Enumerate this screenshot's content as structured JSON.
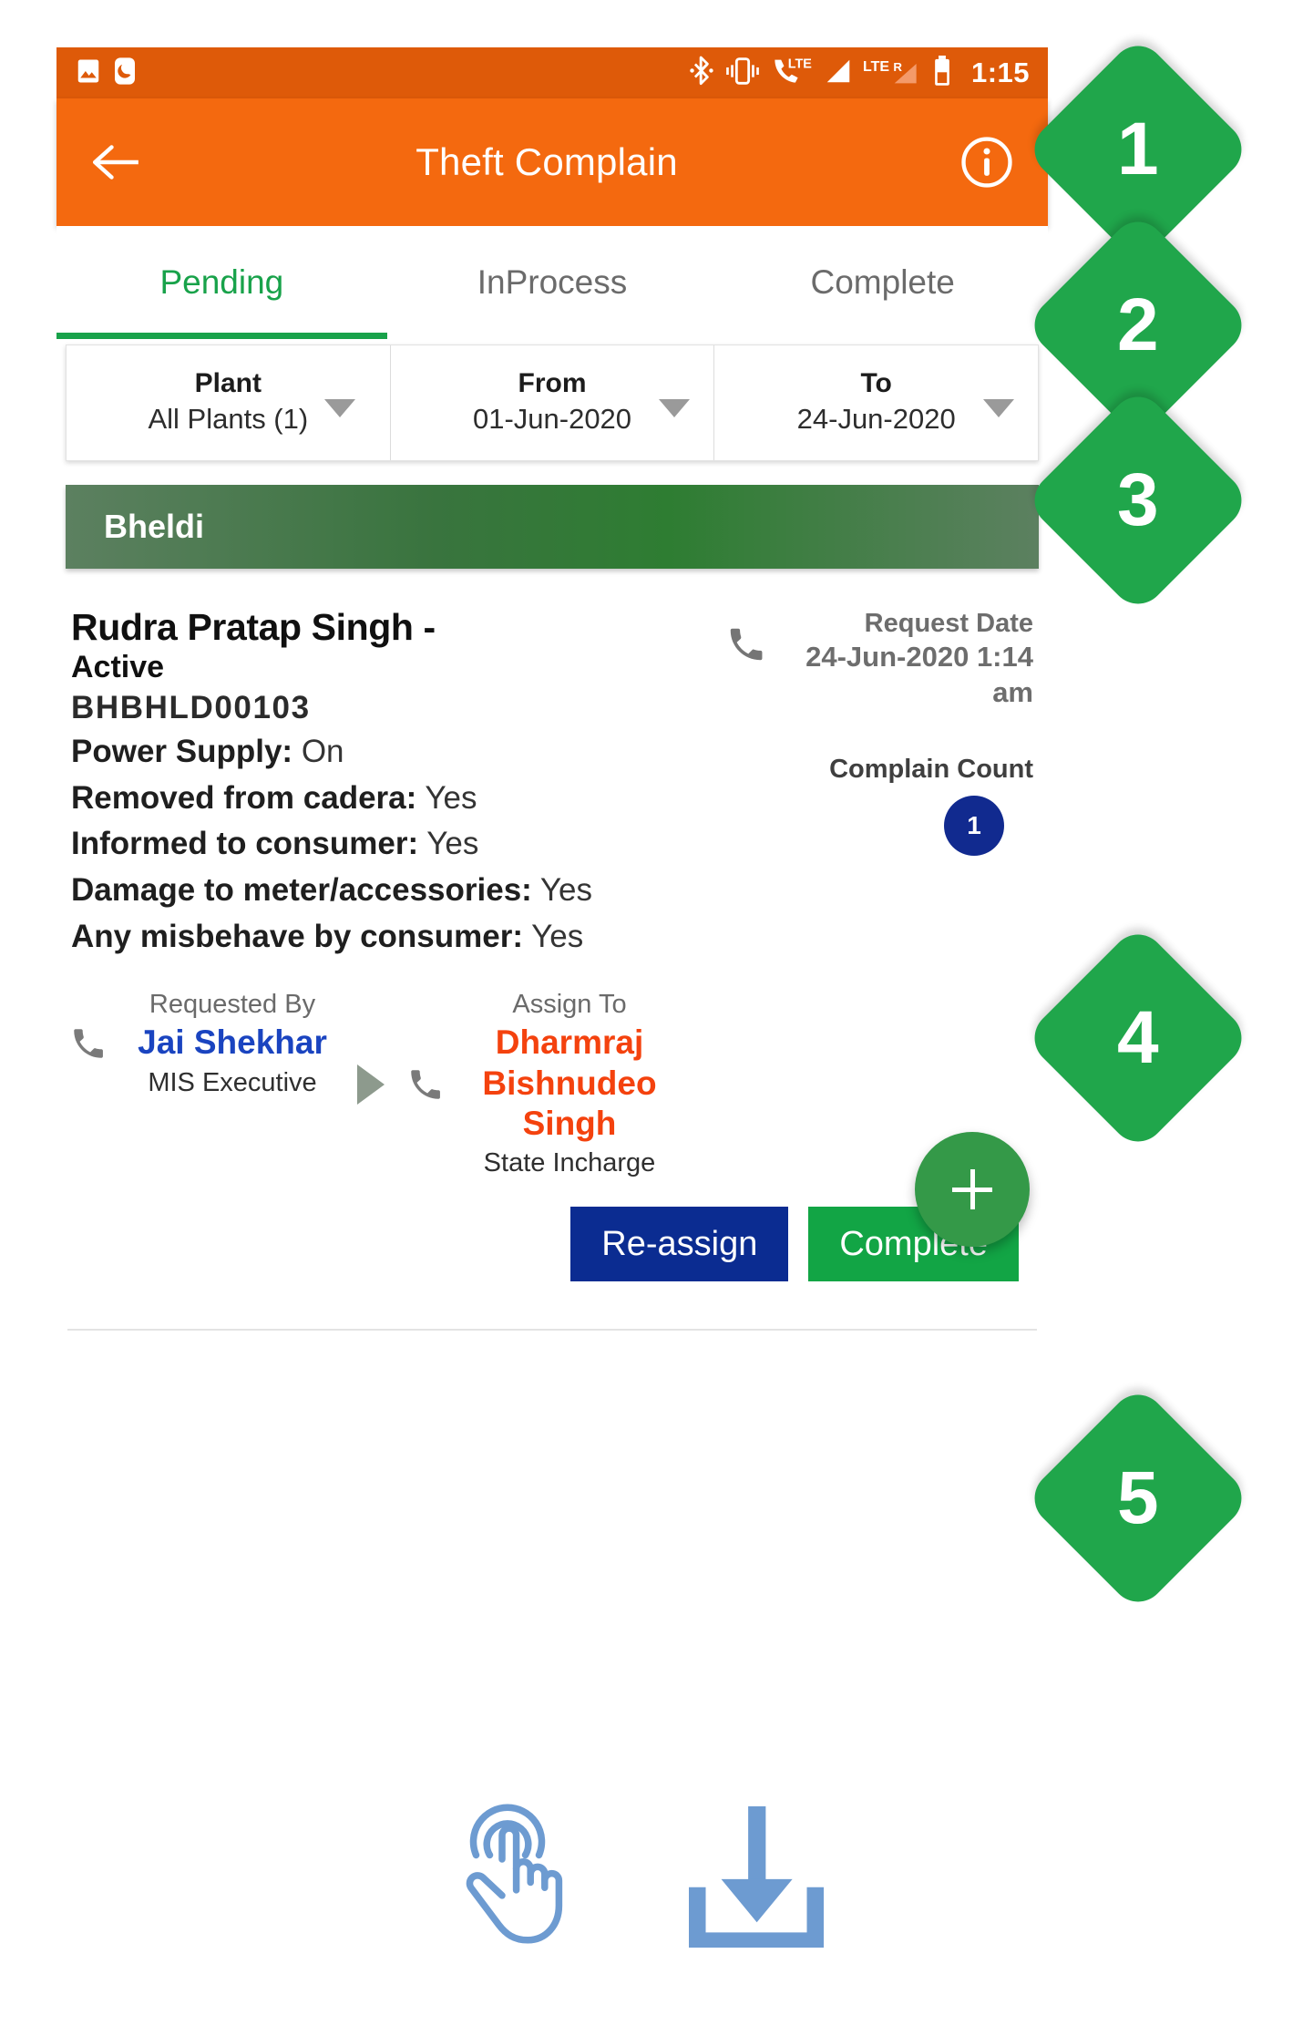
{
  "statusbar": {
    "time": "1:15",
    "icons": [
      "image-icon",
      "moon-icon",
      "bluetooth-icon",
      "vibrate-icon",
      "lte-call-icon",
      "signal-bars-icon",
      "lte-roaming-icon",
      "battery-icon"
    ],
    "lte_label": "LTE",
    "lte_roam_label": "LTE",
    "roam_label": "R",
    "bg_color": "#DE5A09"
  },
  "toolbar": {
    "back_icon": "back-arrow-icon",
    "title": "Theft Complain",
    "info_icon": "info-icon",
    "bg_color": "#F4690F"
  },
  "tabs": {
    "active_color": "#18A24A",
    "items": [
      {
        "label": "Pending",
        "active": true
      },
      {
        "label": "InProcess",
        "active": false
      },
      {
        "label": "Complete",
        "active": false
      }
    ]
  },
  "filters": [
    {
      "label": "Plant",
      "value": "All Plants (1)"
    },
    {
      "label": "From",
      "value": "01-Jun-2020"
    },
    {
      "label": "To",
      "value": "24-Jun-2020"
    }
  ],
  "group_header": {
    "title": "Bheldi",
    "color_start": "#5C8060",
    "color_mid": "#2E7D32"
  },
  "card": {
    "name": "Rudra Pratap Singh -",
    "status": "Active",
    "code": "BHBHLD00103",
    "details": [
      {
        "label": "Power Supply:",
        "value": "On"
      },
      {
        "label": "Removed from cadera:",
        "value": "Yes"
      },
      {
        "label": "Informed to consumer:",
        "value": "Yes"
      },
      {
        "label": "Damage to meter/accessories:",
        "value": "Yes"
      },
      {
        "label": "Any misbehave by consumer:",
        "value": "Yes"
      }
    ],
    "request_date_label": "Request Date",
    "request_date_value": "24-Jun-2020 1:14 am",
    "complain_count_label": "Complain Count",
    "complain_count_value": "1",
    "complain_count_color": "#112A8F",
    "call_icon": "phone-icon",
    "requested_by": {
      "caption": "Requested By",
      "name": "Jai Shekhar",
      "role": "MIS Executive",
      "color": "#1A44C0",
      "call_icon": "phone-icon"
    },
    "assign_to": {
      "caption": "Assign To",
      "name": "Dharmraj Bishnudeo Singh",
      "role": "State Incharge",
      "color": "#F4420E",
      "call_icon": "phone-icon"
    },
    "arrow_icon": "play-arrow-icon",
    "buttons": [
      {
        "label": "Re-assign",
        "color": "#0B2C91"
      },
      {
        "label": "Complete",
        "color": "#12A545"
      }
    ]
  },
  "fab": {
    "icon": "plus-icon",
    "color": "#349948"
  },
  "step_badges": [
    {
      "number": "1"
    },
    {
      "number": "2"
    },
    {
      "number": "3"
    },
    {
      "number": "4"
    },
    {
      "number": "5"
    }
  ],
  "annotations": {
    "tap_icon": "tap-gesture-icon",
    "download_icon": "download-icon",
    "icon_color": "#6D9BD1"
  }
}
